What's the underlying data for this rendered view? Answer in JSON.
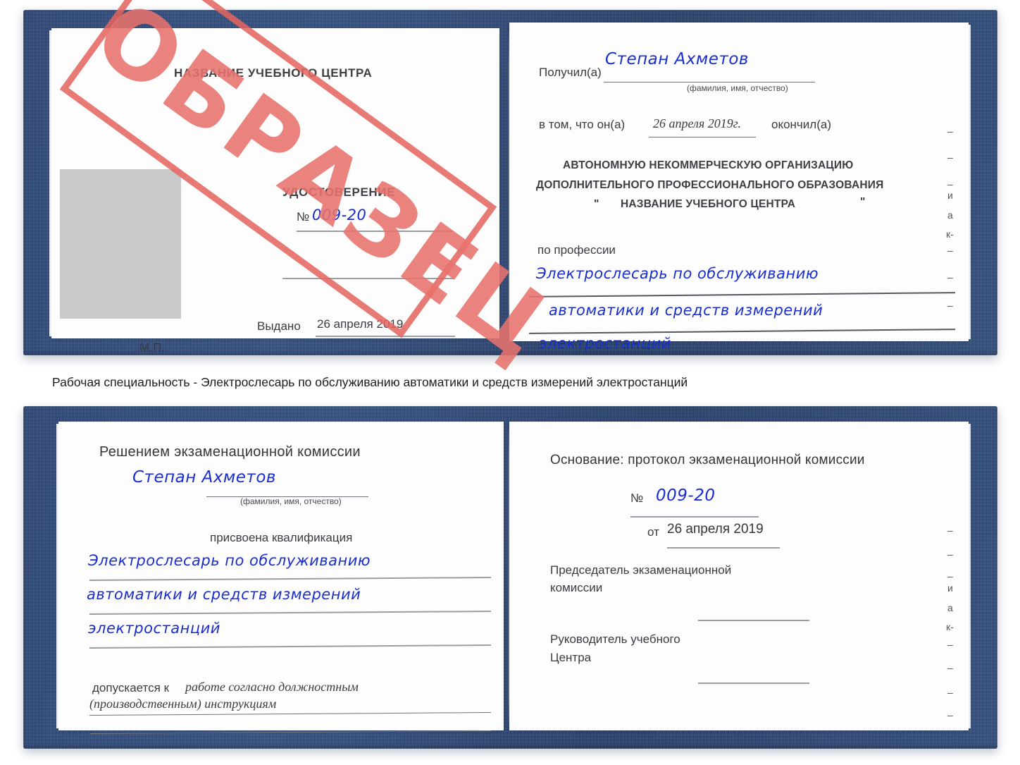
{
  "document": {
    "type": "certificate-scan",
    "stamp_label": "ОБРАЗЕЦ",
    "colors": {
      "cover_blue": "#24427a",
      "stamp_red": "#e8736d",
      "handwriting_blue": "#1a2ed0",
      "photo_placeholder_gray": "#c8c9cb",
      "rule_gray": "#9a9da3"
    }
  },
  "caption": "Рабочая специальность - Электрослесарь по обслуживанию автоматики и средств измерений электростанций",
  "certificate_top": {
    "left_page": {
      "header": "НАЗВАНИЕ УЧЕБНОГО ЦЕНТРА",
      "title": "УДОСТОВЕРЕНИЕ",
      "number_label": "№",
      "number_value": "009-20",
      "issued_label": "Выдано",
      "issued_value": "26 апреля 2019",
      "seal_label": "М.П.",
      "photo_placeholder": "photo-placeholder"
    },
    "right_page": {
      "received_label": "Получил(а)",
      "received_value": "Степан Ахметов",
      "name_hint": "(фамилия, имя, отчество)",
      "that_label": "в том, что он(а)",
      "that_date": "26 апреля 2019г.",
      "finished_label": "окончил(а)",
      "org_line1": "АВТОНОМНУЮ НЕКОММЕРЧЕСКУЮ ОРГАНИЗАЦИЮ",
      "org_line2": "ДОПОЛНИТЕЛЬНОГО ПРОФЕССИОНАЛЬНОГО ОБРАЗОВАНИЯ",
      "org_quote_open": "\"",
      "org_line3": "НАЗВАНИЕ УЧЕБНОГО ЦЕНТРА",
      "org_quote_close": "\"",
      "profession_label": "по профессии",
      "profession_line1": "Электрослесарь по обслуживанию",
      "profession_line2": "автоматики и средств измерений",
      "profession_line3": "электростанций",
      "edge_fragments": [
        "и",
        "а",
        "к-"
      ]
    }
  },
  "certificate_bottom": {
    "left_page": {
      "header": "Решением экзаменационной комиссии",
      "name_value": "Степан Ахметов",
      "name_hint": "(фамилия, имя, отчество)",
      "qualification_label": "присвоена квалификация",
      "qualification_line1": "Электрослесарь по обслуживанию",
      "qualification_line2": "автоматики и средств измерений",
      "qualification_line3": "электростанций",
      "admitted_label": "допускается к",
      "admitted_line1": "работе согласно должностным",
      "admitted_line2": "(производственным) инструкциям"
    },
    "right_page": {
      "basis_label": "Основание: протокол экзаменационной комиссии",
      "number_label": "№",
      "number_value": "009-20",
      "date_label": "от",
      "date_value": "26 апреля 2019",
      "chairman_line1": "Председатель экзаменационной",
      "chairman_line2": "комиссии",
      "head_line1": "Руководитель учебного",
      "head_line2": "Центра",
      "edge_fragments": [
        "и",
        "а",
        "к-"
      ]
    }
  }
}
